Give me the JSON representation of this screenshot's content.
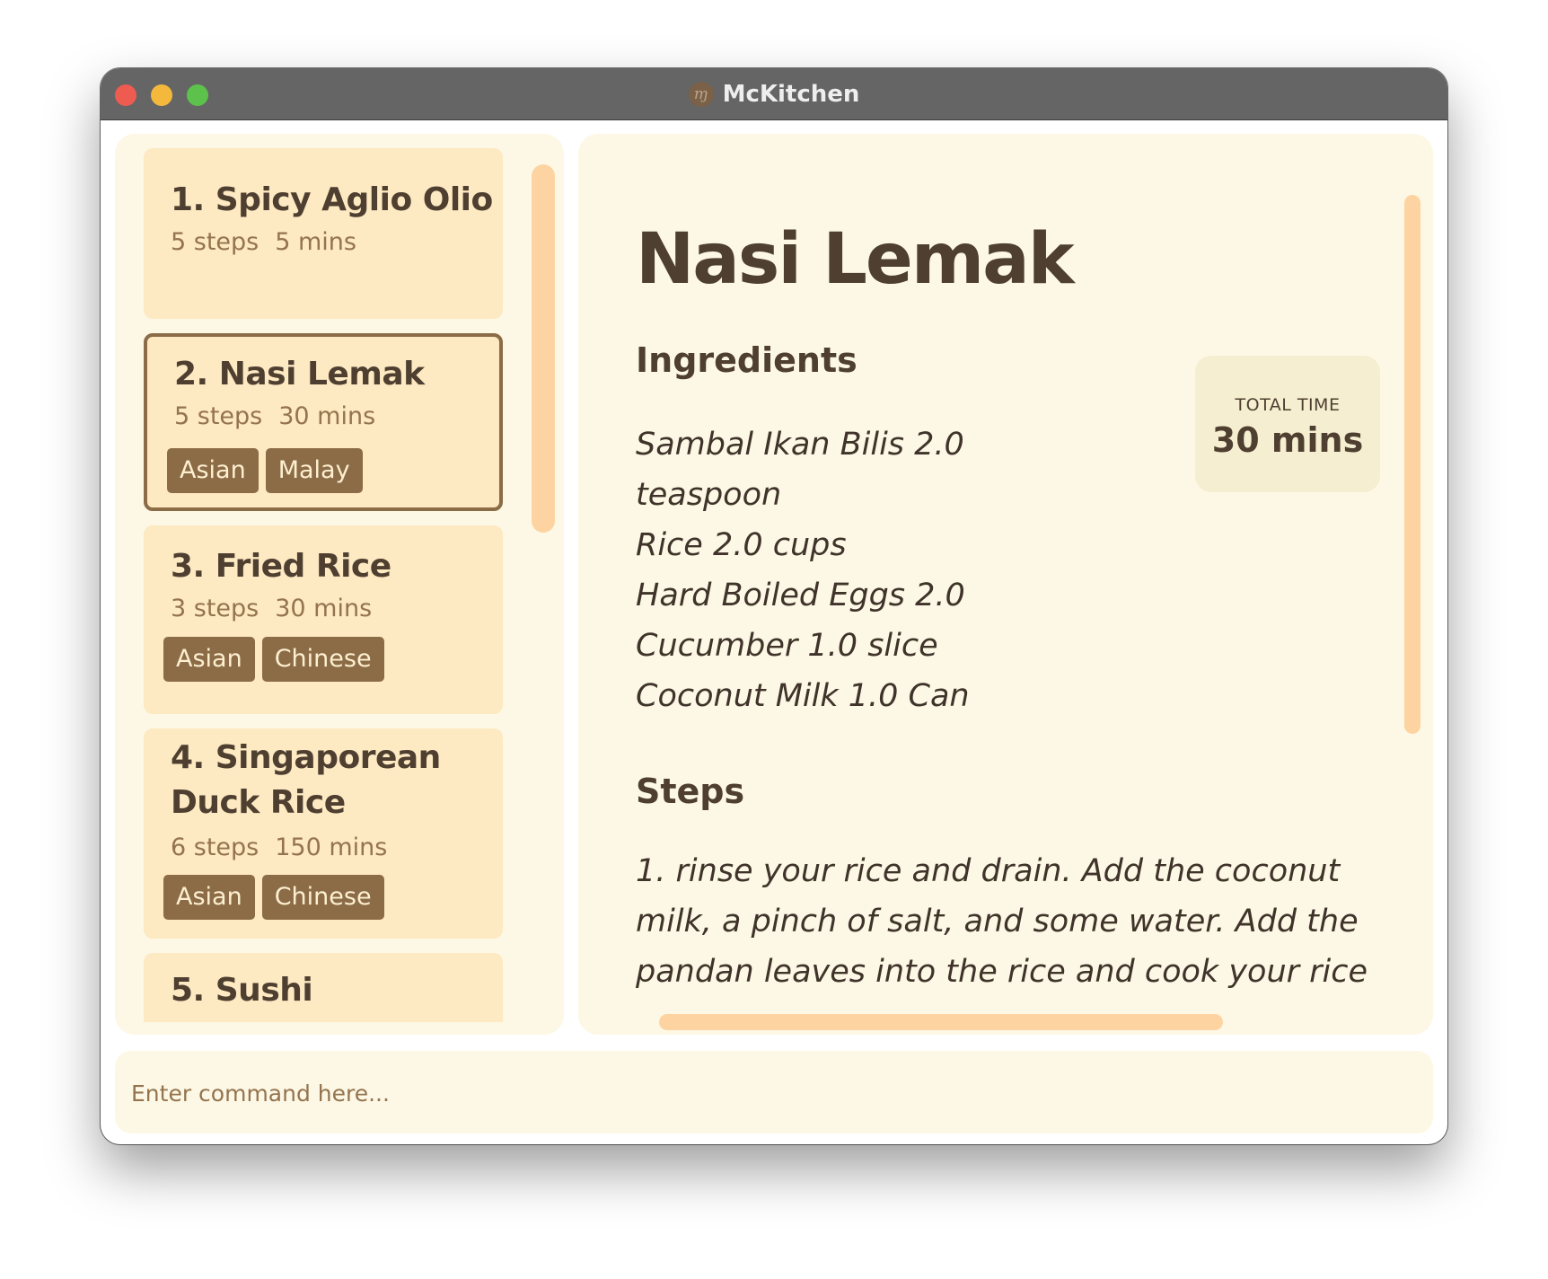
{
  "window": {
    "title": "McKitchen",
    "app_icon_glyph": "ɱ"
  },
  "recipes": [
    {
      "title": "1. Spicy Aglio Olio",
      "steps": "5 steps",
      "time": "5 mins",
      "tags": []
    },
    {
      "title": "2. Nasi Lemak",
      "steps": "5 steps",
      "time": "30 mins",
      "tags": [
        "Asian",
        "Malay"
      ]
    },
    {
      "title": "3. Fried Rice",
      "steps": "3 steps",
      "time": "30 mins",
      "tags": [
        "Asian",
        "Chinese"
      ]
    },
    {
      "title_line1": "4. Singaporean",
      "title_line2": "Duck Rice",
      "steps": "6 steps",
      "time": "150 mins",
      "tags": [
        "Asian",
        "Chinese"
      ]
    },
    {
      "title": "5. Sushi"
    }
  ],
  "detail": {
    "title": "Nasi Lemak",
    "ingredients_heading": "Ingredients",
    "ingredients": [
      "Sambal Ikan Bilis 2.0",
      "teaspoon",
      "Rice 2.0 cups",
      "Hard Boiled Eggs 2.0",
      "Cucumber 1.0 slice",
      "Coconut Milk 1.0 Can"
    ],
    "total_time_label": "TOTAL TIME",
    "total_time_value": "30 mins",
    "steps_heading": "Steps",
    "steps": [
      "1. rinse your rice and drain. Add the coconut",
      "milk, a pinch of salt, and some water. Add the",
      "pandan leaves into the rice and cook your rice"
    ]
  },
  "command": {
    "placeholder": "Enter command here..."
  }
}
